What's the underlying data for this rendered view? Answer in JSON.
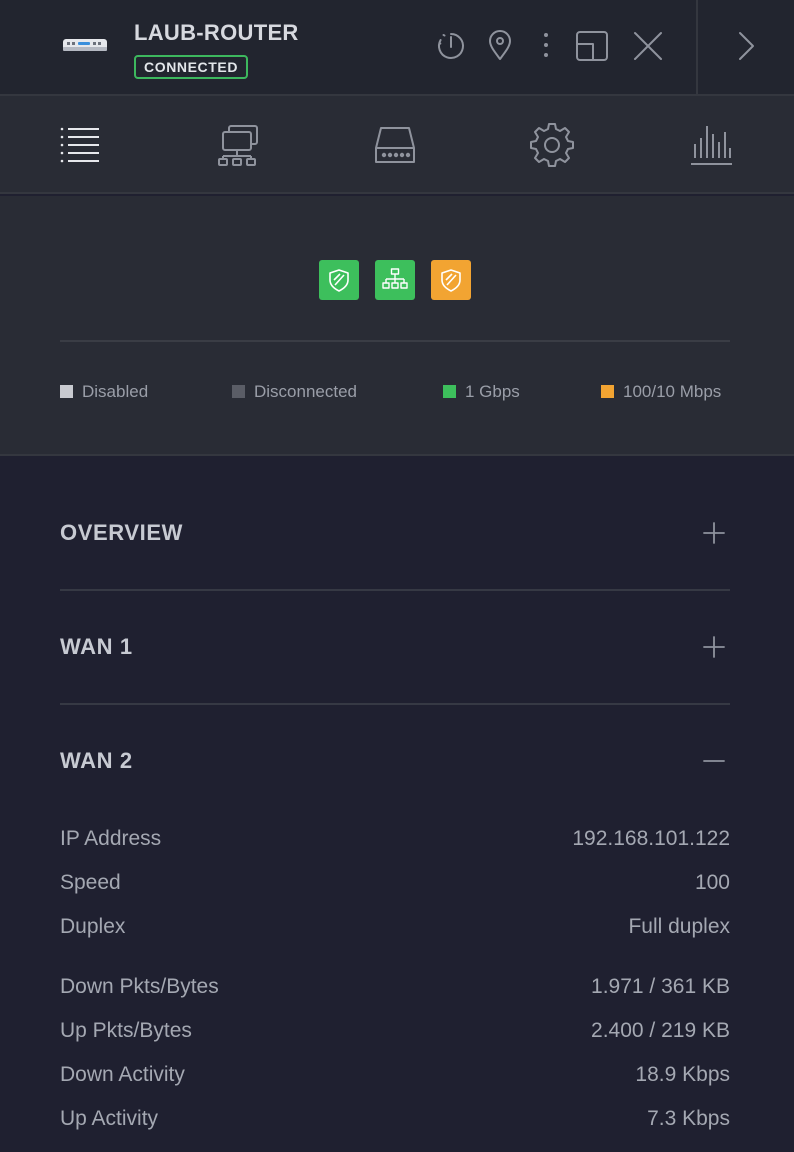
{
  "header": {
    "device_name": "LAUB-ROUTER",
    "status": "CONNECTED",
    "icons": [
      "restart-icon",
      "locate-icon",
      "more-icon",
      "window-icon",
      "close-icon",
      "chevron-right-icon"
    ]
  },
  "tabs": [
    {
      "name": "details-tab",
      "icon": "list-icon"
    },
    {
      "name": "clients-tab",
      "icon": "network-icon"
    },
    {
      "name": "device-tab",
      "icon": "gateway-icon"
    },
    {
      "name": "settings-tab",
      "icon": "gear-icon"
    },
    {
      "name": "statistics-tab",
      "icon": "chart-icon"
    }
  ],
  "ports": [
    {
      "icon": "shield-icon",
      "color": "#3dbf5c"
    },
    {
      "icon": "network-icon",
      "color": "#3dbf5c"
    },
    {
      "icon": "shield-icon",
      "color": "#f2a432"
    }
  ],
  "legend": [
    {
      "label": "Disabled",
      "color": "#c8cad0"
    },
    {
      "label": "Disconnected",
      "color": "#5a5d66"
    },
    {
      "label": "1 Gbps",
      "color": "#3dbf5c"
    },
    {
      "label": "100/10 Mbps",
      "color": "#f2a432"
    }
  ],
  "sections": {
    "overview": {
      "title": "OVERVIEW",
      "expanded": false
    },
    "wan1": {
      "title": "WAN 1",
      "expanded": false
    },
    "wan2": {
      "title": "WAN 2",
      "expanded": true,
      "rows": [
        {
          "label": "IP Address",
          "value": "192.168.101.122"
        },
        {
          "label": "Speed",
          "value": "100"
        },
        {
          "label": "Duplex",
          "value": "Full duplex"
        },
        {
          "label": "Down Pkts/Bytes",
          "value": "1.971 / 361 KB"
        },
        {
          "label": "Up Pkts/Bytes",
          "value": "2.400 / 219 KB"
        },
        {
          "label": "Down Activity",
          "value": "18.9 Kbps"
        },
        {
          "label": "Up Activity",
          "value": "7.3 Kbps"
        }
      ]
    }
  }
}
